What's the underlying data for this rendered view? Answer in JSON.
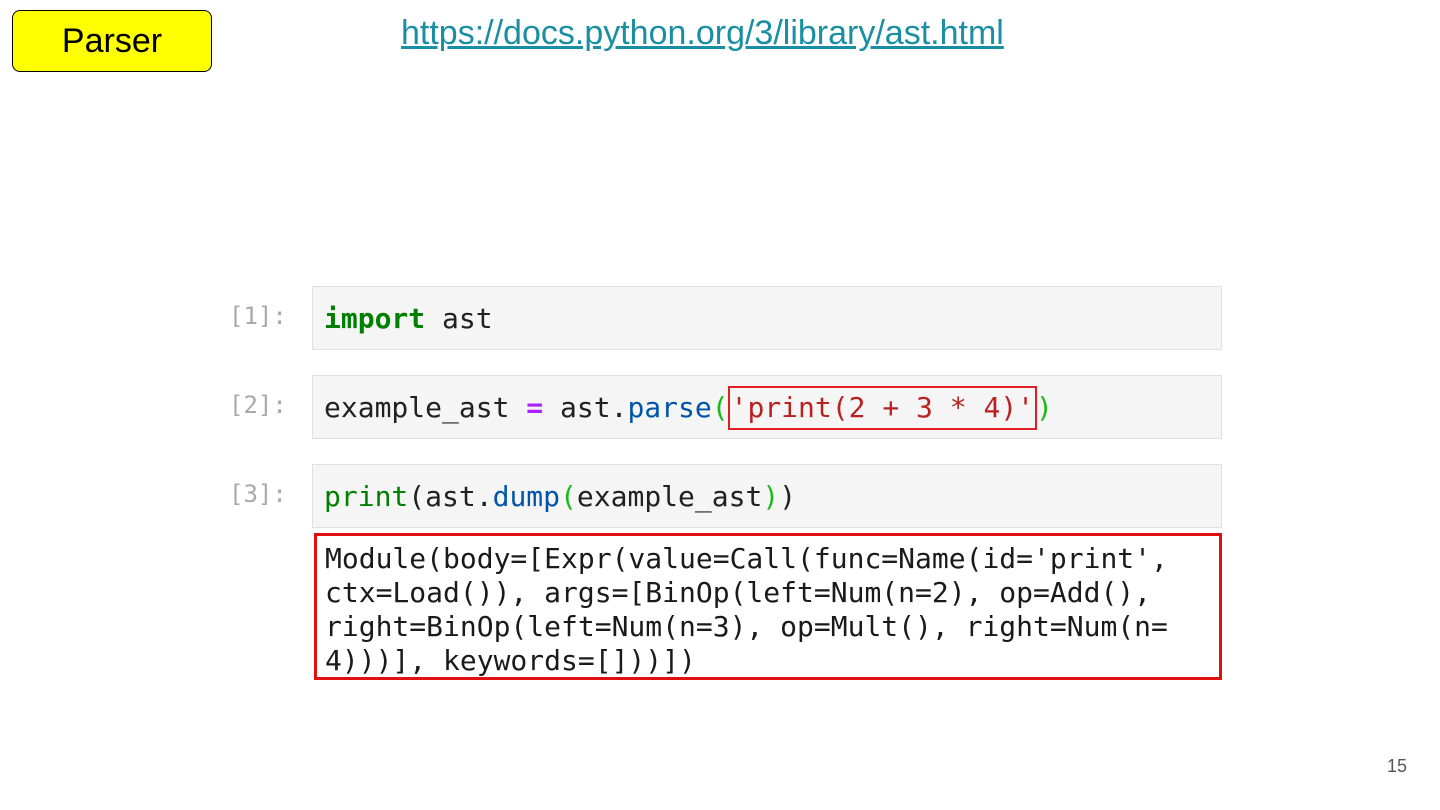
{
  "slide": {
    "title": "Parser",
    "link_text": "https://docs.python.org/3/library/ast.html",
    "page_number": "15"
  },
  "cells": [
    {
      "prompt": "[1]:",
      "code": {
        "keyword": "import",
        "rest": " ast"
      }
    },
    {
      "prompt": "[2]:",
      "code": {
        "var": "example_ast ",
        "op": "=",
        "obj": " ast.",
        "method": "parse",
        "open": "(",
        "string": "'print(2 + 3 * 4)'",
        "close": ")"
      }
    },
    {
      "prompt": "[3]:",
      "code": {
        "builtin": "print",
        "open1": "(",
        "obj": "ast.",
        "method": "dump",
        "open2": "(",
        "arg": "example_ast",
        "close2": ")",
        "close1": ")"
      }
    }
  ],
  "output": {
    "lines": [
      "Module(body=[Expr(value=Call(func=Name(id='print',",
      "ctx=Load()), args=[BinOp(left=Num(n=2), op=Add(),",
      "right=BinOp(left=Num(n=3), op=Mult(), right=Num(n=",
      "4)))], keywords=[]))])"
    ]
  },
  "colors": {
    "title_background": "#ffff00",
    "link": "#1a8fa3",
    "highlight_border": "#e01010",
    "keyword": "#008000",
    "string": "#ba2121",
    "operator": "#aa22ff"
  }
}
